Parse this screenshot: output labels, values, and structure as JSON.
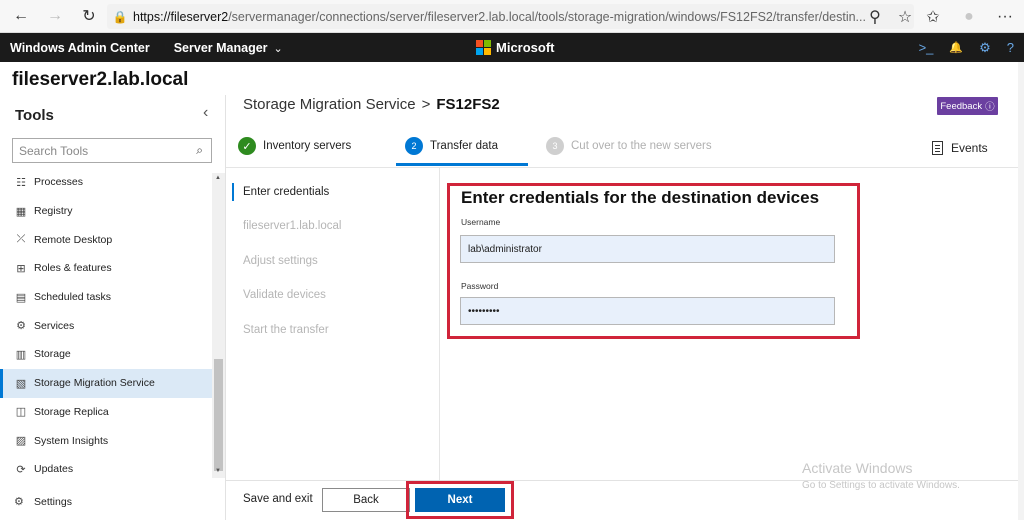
{
  "browser": {
    "back_glyph": "←",
    "forward_glyph": "→",
    "refresh_glyph": "↻",
    "lock_glyph": "🔒",
    "url_host": "https://fileserver2",
    "url_rest": "/servermanager/connections/server/fileserver2.lab.local/tools/storage-migration/windows/FS12FS2/transfer/destin...",
    "key_glyph": "⚲",
    "star_glyph": "☆",
    "favorites_glyph": "✩",
    "profile_glyph": "●",
    "more_glyph": "···"
  },
  "header": {
    "app_title": "Windows Admin Center",
    "context": "Server Manager",
    "context_chevron": "⌄",
    "brand": "Microsoft",
    "brand_colors": [
      "#f25022",
      "#7fba00",
      "#00a4ef",
      "#ffb900"
    ],
    "icons": {
      "terminal": ">_",
      "notifications": "🔔",
      "settings": "⚙",
      "help": "?"
    }
  },
  "server_name": "fileserver2.lab.local",
  "sidebar": {
    "title": "Tools",
    "collapse_glyph": "‹",
    "search_placeholder": "Search Tools",
    "items": [
      {
        "label": "Processes",
        "icon": "☷"
      },
      {
        "label": "Registry",
        "icon": "▦"
      },
      {
        "label": "Remote Desktop",
        "icon": "⤫"
      },
      {
        "label": "Roles & features",
        "icon": "⊞"
      },
      {
        "label": "Scheduled tasks",
        "icon": "▤"
      },
      {
        "label": "Services",
        "icon": "⚙"
      },
      {
        "label": "Storage",
        "icon": "▥"
      },
      {
        "label": "Storage Migration Service",
        "icon": "▧"
      },
      {
        "label": "Storage Replica",
        "icon": "◫"
      },
      {
        "label": "System Insights",
        "icon": "▨"
      },
      {
        "label": "Updates",
        "icon": "⟳"
      }
    ],
    "selected_index": 7,
    "settings_label": "Settings",
    "settings_icon": "⚙"
  },
  "breadcrumb": {
    "parent": "Storage Migration Service",
    "sep": ">",
    "current": "FS12FS2"
  },
  "feedback": {
    "label": "Feedback",
    "icon": "ⓘ"
  },
  "steps": [
    {
      "number": "✓",
      "label": "Inventory servers",
      "state": "done"
    },
    {
      "number": "2",
      "label": "Transfer data",
      "state": "active"
    },
    {
      "number": "3",
      "label": "Cut over to the new servers",
      "state": "pending"
    }
  ],
  "events_label": "Events",
  "substeps": [
    "Enter credentials",
    "fileserver1.lab.local",
    "Adjust settings",
    "Validate devices",
    "Start the transfer"
  ],
  "active_substep": 0,
  "form": {
    "title": "Enter credentials for the destination devices",
    "username_label": "Username",
    "username_value": "lab\\administrator",
    "password_label": "Password",
    "password_value": "•••••••••"
  },
  "footer": {
    "save_exit": "Save and exit",
    "back": "Back",
    "next": "Next"
  },
  "watermark": {
    "title": "Activate Windows",
    "subtitle": "Go to Settings to activate Windows."
  },
  "colors": {
    "accent": "#0078d4",
    "highlight_box": "#d0243a",
    "feedback_purple": "#6b3fa0",
    "done_green": "#2e8b1f"
  }
}
